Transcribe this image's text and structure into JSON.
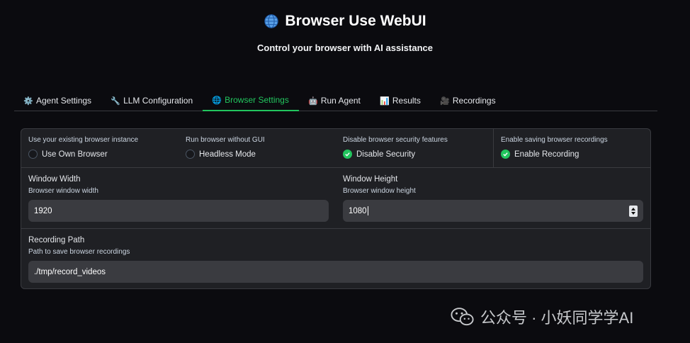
{
  "header": {
    "title": "Browser Use WebUI",
    "subtitle": "Control your browser with AI assistance",
    "title_icon": "globe-icon"
  },
  "tabs": [
    {
      "label": "Agent Settings",
      "icon": "⚙️",
      "active": false
    },
    {
      "label": "LLM Configuration",
      "icon": "🔧",
      "active": false
    },
    {
      "label": "Browser Settings",
      "icon": "🌐",
      "active": true
    },
    {
      "label": "Run Agent",
      "icon": "🤖",
      "active": false
    },
    {
      "label": "Results",
      "icon": "📊",
      "active": false
    },
    {
      "label": "Recordings",
      "icon": "🎥",
      "active": false
    }
  ],
  "settings": {
    "own_browser": {
      "description": "Use your existing browser instance",
      "label": "Use Own Browser",
      "checked": false
    },
    "headless": {
      "description": "Run browser without GUI",
      "label": "Headless Mode",
      "checked": false
    },
    "disable_security": {
      "description": "Disable browser security features",
      "label": "Disable Security",
      "checked": true
    },
    "enable_recording": {
      "description": "Enable saving browser recordings",
      "label": "Enable Recording",
      "checked": true
    }
  },
  "window_width": {
    "title": "Window Width",
    "description": "Browser window width",
    "value": "1920"
  },
  "window_height": {
    "title": "Window Height",
    "description": "Browser window height",
    "value": "1080"
  },
  "recording_path": {
    "title": "Recording Path",
    "description": "Path to save browser recordings",
    "value": "./tmp/record_videos"
  },
  "watermark": {
    "text": "公众号 · 小妖同学学AI"
  },
  "colors": {
    "accent": "#22c55e",
    "background": "#0b0b0f",
    "panel": "#1f2024",
    "input": "#3a3b40"
  }
}
